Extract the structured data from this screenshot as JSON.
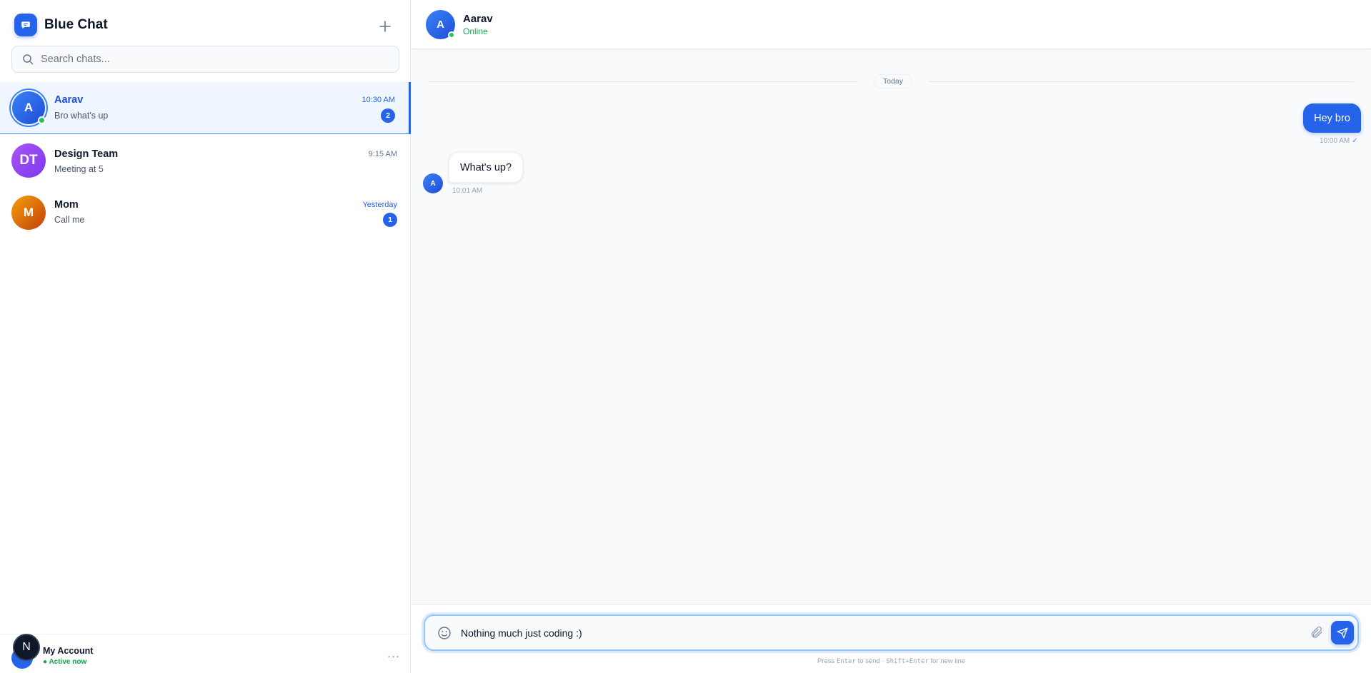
{
  "app": {
    "title": "Blue Chat",
    "logo_icon": "chat-bubble-icon",
    "new_chat_icon": "plus-icon"
  },
  "search": {
    "placeholder": "Search chats...",
    "value": ""
  },
  "chats": [
    {
      "initials": "A",
      "name": "Aarav",
      "preview": "Bro what's up",
      "time": "10:30 AM",
      "unread": "2",
      "online": true,
      "active": true
    },
    {
      "initials": "DT",
      "name": "Design Team",
      "preview": "Meeting at 5",
      "time": "9:15 AM",
      "unread": "",
      "online": false,
      "active": false
    },
    {
      "initials": "M",
      "name": "Mom",
      "preview": "Call me",
      "time": "Yesterday",
      "unread": "1",
      "online": false,
      "active": false
    }
  ],
  "account": {
    "avatar_letter": "N",
    "name": "My Account",
    "status": "● Active now",
    "more": "···"
  },
  "conversation": {
    "contact_initial": "A",
    "contact_name": "Aarav",
    "contact_status": "Online",
    "date_divider": "Today",
    "messages": [
      {
        "direction": "out",
        "text": "Hey bro",
        "time": "10:00 AM",
        "status": "✓"
      },
      {
        "direction": "in",
        "avatar": "A",
        "text": "What's up?",
        "time": "10:01 AM"
      }
    ]
  },
  "composer": {
    "value": "Nothing much just coding :)",
    "hint_prefix": "Press",
    "hint_key1": "Enter",
    "hint_mid": "to send ·",
    "hint_key2": "Shift+Enter",
    "hint_suffix": "for new line"
  },
  "colors": {
    "accent": "#2563eb",
    "online": "#22c55e",
    "purple": "#7c3aed",
    "orange": "#d97706"
  }
}
